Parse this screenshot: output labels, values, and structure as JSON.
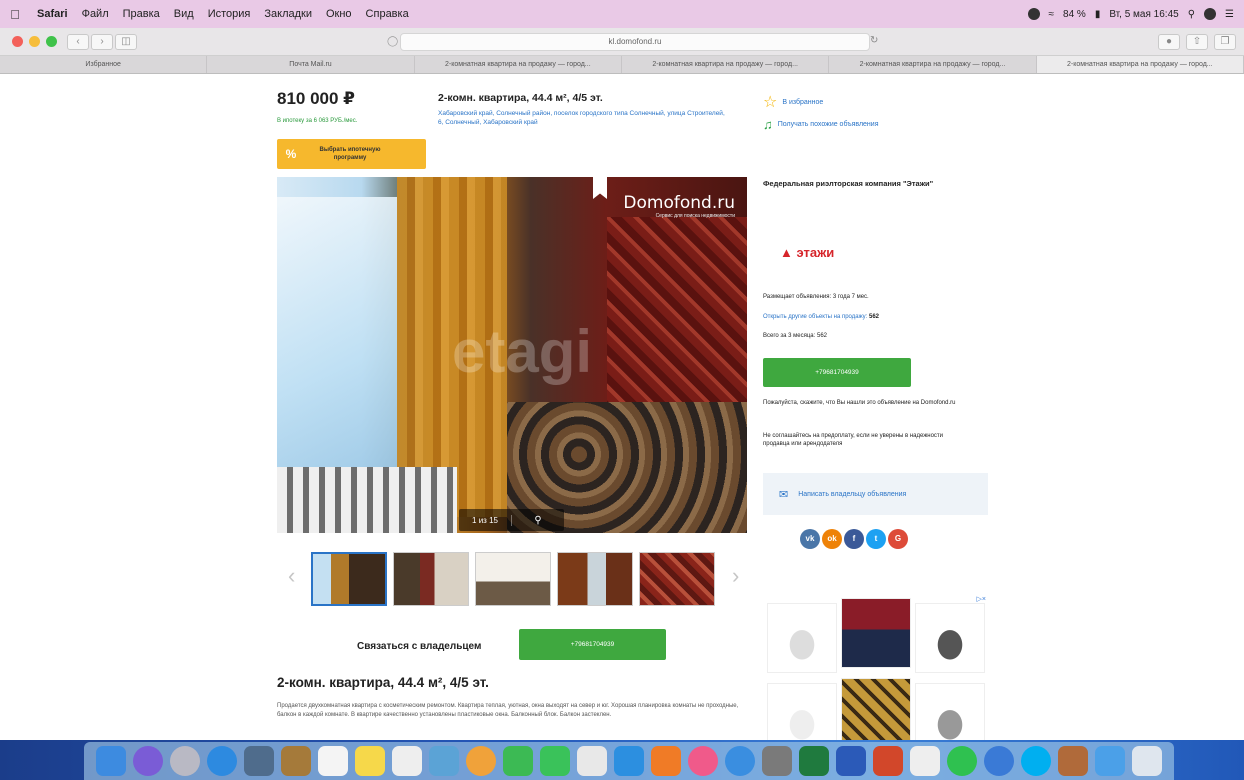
{
  "menubar": {
    "app": "Safari",
    "items": [
      "Файл",
      "Правка",
      "Вид",
      "История",
      "Закладки",
      "Окно",
      "Справка"
    ],
    "battery": "84 %",
    "datetime": "Вт, 5 мая 16:45"
  },
  "browser": {
    "url": "kl.domofond.ru",
    "tabs": [
      "Избранное",
      "Почта Mail.ru",
      "2-комнатная квартира на продажу — город...",
      "2-комнатная квартира на продажу — город...",
      "2-комнатная квартира на продажу — город...",
      "2-комнатная квартира на продажу — город..."
    ]
  },
  "listing": {
    "price": "810 000 ₽",
    "mortgage_text": "В ипотеку за 6 063 РУБ./мес.",
    "mortgage_button": "Выбрать ипотечную программу",
    "title_top": "2-комн. квартира, 44.4 м², 4/5 эт.",
    "address": "Хабаровский край, Солнечный район, поселок городского типа Солнечный, улица Строителей, 6, Солнечный, Хабаровский край",
    "favorite": "В избранное",
    "similar": "Получать похожие объявления",
    "photo_logo": "Domofond.ru",
    "photo_logo_sub": "Сервис для поиска недвижимости",
    "photo_watermark": "etagi",
    "photo_counter": "1 из 15",
    "contact_label": "Связаться с владельцем",
    "phone": "+79681704939",
    "title_main": "2-комн. квартира, 44.4 м², 4/5 эт.",
    "description": "Продается двухкомнатная квартира с косметическим ремонтом. Квартира теплая, уютная, окна выходят на север и юг. Хорошая планировка комнаты не проходные, балкон в каждой комнате. В квартире качественно установлены пластиковые окна. Балконный блок. Балкон застеклен."
  },
  "sidebar": {
    "agency": "Федеральная риэлторская компания \"Этажи\"",
    "brand": "этажи",
    "posting": "Размещает объявления: 3 года 7 мес.",
    "other_link": "Открыть другие объекты на продажу:",
    "other_count": "562",
    "total": "Всего за 3 месяца: 562",
    "phone": "+79681704939",
    "notice1": "Пожалуйста, скажите, что Вы нашли это объявление на Domofond.ru",
    "notice2": "Не соглашайтесь на предоплату, если не уверены в надежности продавца или арендодателя",
    "write_owner": "Написать владельцу объявления",
    "social": [
      "vk",
      "ok",
      "f",
      "t",
      "G"
    ]
  },
  "colors": {
    "menubar": "#e9c9e6",
    "accent_link": "#2a74c7",
    "green_button": "#3fa83f",
    "mortgage_button": "#f6b82d",
    "brand_red": "#d6252b"
  }
}
